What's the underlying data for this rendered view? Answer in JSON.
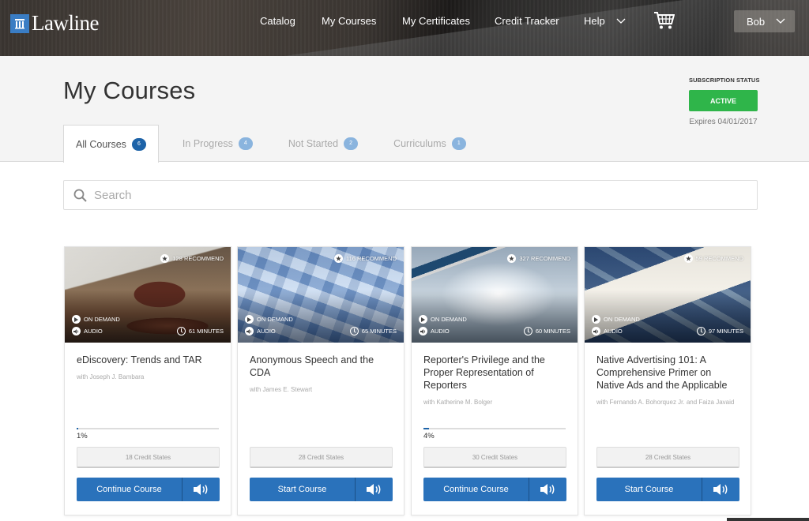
{
  "header": {
    "brand": "Lawline",
    "nav": [
      {
        "label": "Catalog"
      },
      {
        "label": "My Courses"
      },
      {
        "label": "My Certificates"
      },
      {
        "label": "Credit Tracker"
      },
      {
        "label": "Help"
      }
    ],
    "cart_icon": "shopping-cart-icon",
    "user": "Bob"
  },
  "page": {
    "title": "My Courses",
    "subscription": {
      "label": "SUBSCRIPTION STATUS",
      "status": "ACTIVE",
      "status_color": "#2fb54a",
      "expires": "Expires 04/01/2017"
    },
    "tabs": [
      {
        "label": "All Courses",
        "count": "6",
        "active": true
      },
      {
        "label": "In Progress",
        "count": "4",
        "active": false
      },
      {
        "label": "Not Started",
        "count": "2",
        "active": false
      },
      {
        "label": "Curriculums",
        "count": "1",
        "active": false
      }
    ],
    "search": {
      "placeholder": "Search",
      "value": ""
    }
  },
  "courses": [
    {
      "recommend": "128 RECOMMEND",
      "format": "ON DEMAND",
      "media": "AUDIO",
      "duration": "61 MINUTES",
      "title": "eDiscovery: Trends and TAR",
      "author": "with Joseph J. Bambara",
      "progress": 1,
      "progress_label": "1%",
      "credits": "18 Credit States",
      "action": "Continue Course"
    },
    {
      "recommend": "116 RECOMMEND",
      "format": "ON DEMAND",
      "media": "AUDIO",
      "duration": "65 MINUTES",
      "title": "Anonymous Speech and the CDA",
      "author": "with James E. Stewart",
      "progress": null,
      "progress_label": "",
      "credits": "28 Credit States",
      "action": "Start Course"
    },
    {
      "recommend": "327 RECOMMEND",
      "format": "ON DEMAND",
      "media": "AUDIO",
      "duration": "60 MINUTES",
      "title": "Reporter's Privilege and the Proper Representation of Reporters",
      "author": "with Katherine M. Bolger",
      "progress": 4,
      "progress_label": "4%",
      "credits": "30 Credit States",
      "action": "Continue Course"
    },
    {
      "recommend": "59 RECOMMEND",
      "format": "ON DEMAND",
      "media": "AUDIO",
      "duration": "97 MINUTES",
      "title": "Native Advertising 101: A Comprehensive Primer on Native Ads and the Applicable",
      "author": "with Fernando A. Bohorquez Jr. and Faiza Javaid",
      "progress": null,
      "progress_label": "",
      "credits": "28 Credit States",
      "action": "Start Course"
    }
  ]
}
